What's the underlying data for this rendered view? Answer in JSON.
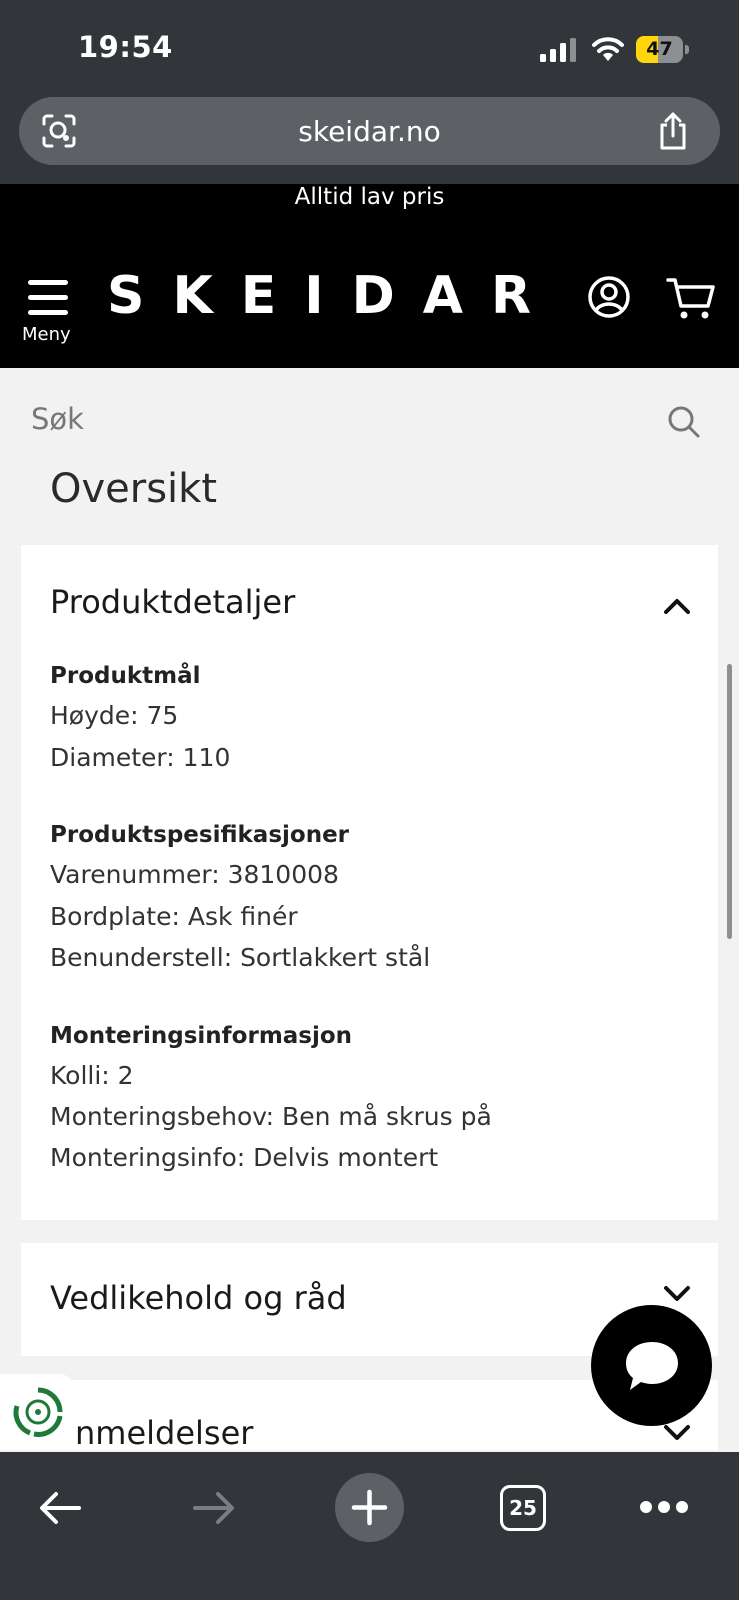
{
  "status_bar": {
    "time": "19:54",
    "battery": "47"
  },
  "browser": {
    "url": "skeidar.no",
    "tab_count": "25"
  },
  "site": {
    "promo": "Alltid lav pris",
    "logo": "SKEIDAR",
    "menu_label": "Meny"
  },
  "search": {
    "placeholder": "Søk"
  },
  "page": {
    "heading": "Oversikt"
  },
  "product_details": {
    "title": "Produktdetaljer",
    "sections": [
      {
        "heading": "Produktmål",
        "rows": [
          "Høyde: 75",
          "Diameter: 110"
        ]
      },
      {
        "heading": "Produktspesifikasjoner",
        "rows": [
          "Varenummer: 3810008",
          "Bordplate: Ask finér",
          "Benunderstell: Sortlakkert stål"
        ]
      },
      {
        "heading": "Monteringsinformasjon",
        "rows": [
          "Kolli: 2",
          "Monteringsbehov: Ben må skrus på",
          "Monteringsinfo: Delvis montert"
        ]
      }
    ]
  },
  "accordion": {
    "care_title": "Vedlikehold og råd",
    "reviews_title": "nmeldelser"
  }
}
